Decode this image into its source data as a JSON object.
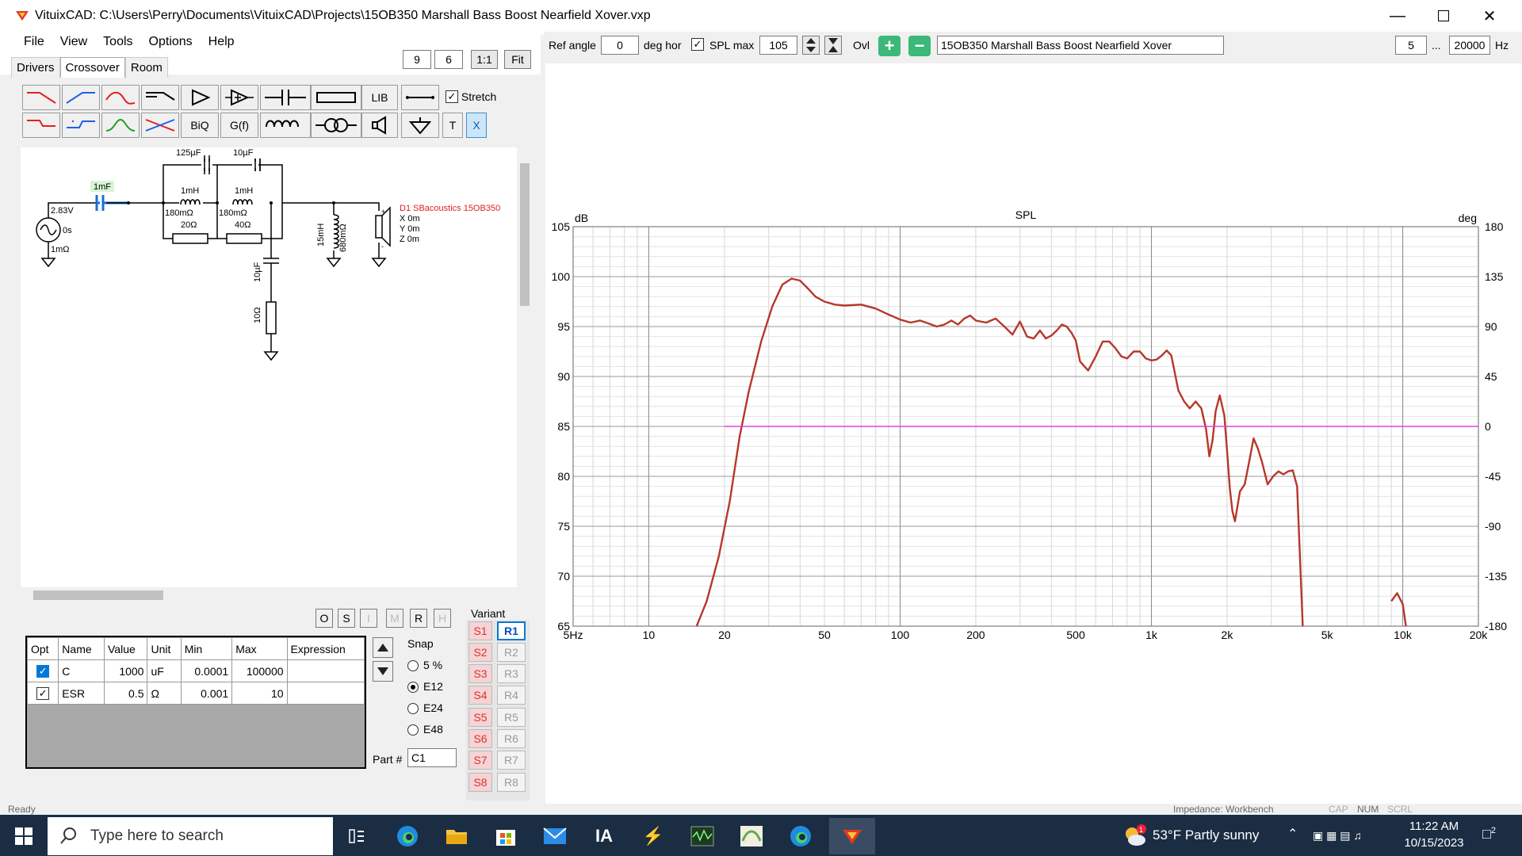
{
  "window": {
    "title": "VituixCAD: C:\\Users\\Perry\\Documents\\VituixCAD\\Projects\\15OB350 Marshall Bass Boost Nearfield Xover.vxp"
  },
  "menu": [
    "File",
    "View",
    "Tools",
    "Options",
    "Help"
  ],
  "tabs": [
    "Drivers",
    "Crossover",
    "Room"
  ],
  "zoom": {
    "a": "9",
    "b": "6",
    "one": "1:1",
    "fit": "Fit"
  },
  "toolbar": {
    "lib": "LIB",
    "biq": "BiQ",
    "gf": "G(f)",
    "t": "T",
    "x": "X",
    "stretch": "Stretch"
  },
  "schematic": {
    "source_v": "2.83V",
    "source_delay": "0s",
    "source_r": "1mΩ",
    "cap1": "1mF",
    "c125": "125µF",
    "c10a": "10µF",
    "l1": "1mH",
    "l2": "1mH",
    "r180a": "180mΩ",
    "r180b": "180mΩ",
    "r20": "20Ω",
    "r40": "40Ω",
    "c10b": "10µF",
    "r10": "10Ω",
    "l15": "15mH",
    "r680": "680mΩ",
    "driver": "D1 SBacoustics 15OB350",
    "dx": "X 0m",
    "dy": "Y 0m",
    "dz": "Z 0m"
  },
  "mode_buttons": [
    "O",
    "S",
    "I",
    "M",
    "R",
    "H"
  ],
  "table": {
    "headers": [
      "Opt",
      "Name",
      "Value",
      "Unit",
      "Min",
      "Max",
      "Expression"
    ],
    "rows": [
      {
        "name": "C",
        "value": "1000",
        "unit": "uF",
        "min": "0.0001",
        "max": "100000",
        "expr": ""
      },
      {
        "name": "ESR",
        "value": "0.5",
        "unit": "Ω",
        "min": "0.001",
        "max": "10",
        "expr": ""
      }
    ]
  },
  "snap": {
    "label": "Snap",
    "options": [
      "5 %",
      "E12",
      "E24",
      "E48"
    ],
    "selected": "E12"
  },
  "part": {
    "label": "Part #",
    "value": "C1"
  },
  "variant": {
    "label": "Variant",
    "s": [
      "S1",
      "S2",
      "S3",
      "S4",
      "S5",
      "S6",
      "S7",
      "S8"
    ],
    "r": [
      "R1",
      "R2",
      "R3",
      "R4",
      "R5",
      "R6",
      "R7",
      "R8"
    ]
  },
  "topbar": {
    "ref_angle_label": "Ref angle",
    "ref_angle": "0",
    "deg_hor": "deg hor",
    "spl_max_label": "SPL max",
    "spl_max": "105",
    "ovl": "Ovl",
    "project_name": "15OB350 Marshall Bass Boost Nearfield Xover",
    "f_min": "5",
    "dots": "...",
    "f_max": "20000",
    "hz": "Hz"
  },
  "chart_data": {
    "type": "line",
    "title": "SPL",
    "ylabel": "dB",
    "y2label": "deg",
    "ylim": [
      65,
      105
    ],
    "y_ticks": [
      "105",
      "100",
      "95",
      "90",
      "85",
      "80",
      "75",
      "70",
      "65"
    ],
    "y2_ticks": [
      "180",
      "135",
      "90",
      "45",
      "0",
      "-45",
      "-90",
      "-135",
      "-180"
    ],
    "xlim": [
      5,
      20000
    ],
    "xscale": "log",
    "x_ticks": [
      {
        "v": 5,
        "l": "5Hz"
      },
      {
        "v": 10,
        "l": "10"
      },
      {
        "v": 20,
        "l": "20"
      },
      {
        "v": 50,
        "l": "50"
      },
      {
        "v": 100,
        "l": "100"
      },
      {
        "v": 200,
        "l": "200"
      },
      {
        "v": 500,
        "l": "500"
      },
      {
        "v": 1000,
        "l": "1k"
      },
      {
        "v": 2000,
        "l": "2k"
      },
      {
        "v": 5000,
        "l": "5k"
      },
      {
        "v": 10000,
        "l": "10k"
      },
      {
        "v": 20000,
        "l": "20k"
      }
    ],
    "series": [
      {
        "color": "#b7372a",
        "x": [
          15.5,
          17,
          19,
          21,
          23,
          25,
          28,
          31,
          34,
          37,
          40,
          43,
          46,
          50,
          55,
          60,
          70,
          80,
          90,
          100,
          110,
          120,
          130,
          140,
          150,
          160,
          170,
          180,
          190,
          200,
          220,
          240,
          260,
          280,
          300,
          320,
          340,
          360,
          380,
          400,
          420,
          440,
          460,
          480,
          500,
          520,
          560,
          600,
          640,
          680,
          720,
          760,
          800,
          850,
          900,
          950,
          1000,
          1050,
          1100,
          1150,
          1200,
          1280,
          1350,
          1420,
          1500,
          1580,
          1650,
          1700,
          1750,
          1800,
          1870,
          1950,
          2000,
          2050,
          2100,
          2150,
          2200,
          2250,
          2350,
          2450,
          2550,
          2650,
          2750,
          2900,
          3050,
          3200,
          3350,
          3500,
          3650,
          3800,
          4000,
          4200,
          4350,
          4500,
          4650,
          4750,
          4850,
          5100,
          9000,
          9500,
          10000,
          10300
        ],
        "y": [
          65,
          67.5,
          72,
          77.5,
          84,
          88.5,
          93.5,
          97,
          99.2,
          99.8,
          99.6,
          98.8,
          98,
          97.5,
          97.2,
          97.1,
          97.2,
          96.8,
          96.2,
          95.7,
          95.4,
          95.6,
          95.3,
          95.0,
          95.2,
          95.6,
          95.2,
          95.8,
          96.1,
          95.6,
          95.4,
          95.8,
          95.0,
          94.2,
          95.5,
          94.0,
          93.8,
          94.6,
          93.8,
          94.1,
          94.6,
          95.2,
          95.0,
          94.4,
          93.6,
          91.5,
          90.6,
          92.0,
          93.5,
          93.5,
          92.8,
          92.0,
          91.8,
          92.5,
          92.5,
          91.8,
          91.6,
          91.7,
          92.1,
          92.6,
          92.1,
          88.6,
          87.5,
          86.8,
          87.5,
          86.8,
          84.7,
          82.0,
          83.6,
          86.5,
          88.1,
          86.1,
          82.5,
          78.8,
          76.5,
          75.5,
          77,
          78.5,
          79.2,
          81.5,
          83.8,
          82.8,
          81.5,
          79.2,
          80,
          80.5,
          80.2,
          80.5,
          80.6,
          79.0,
          65,
          null,
          null,
          null,
          null,
          null,
          null,
          null,
          67.5,
          68.3,
          67.2,
          65
        ]
      },
      {
        "color": "#e040e0",
        "x": [
          20,
          20000
        ],
        "y": [
          85,
          85
        ]
      }
    ]
  },
  "status": {
    "left": "Ready",
    "right": "Impedance: Workbench",
    "caps": "CAP",
    "num": "NUM",
    "scrl": "SCRL"
  },
  "taskbar": {
    "search": "Type here to search",
    "weather": "53°F  Partly sunny",
    "time": "11:22 AM",
    "date": "10/15/2023",
    "badge": "1",
    "notif": "2"
  }
}
